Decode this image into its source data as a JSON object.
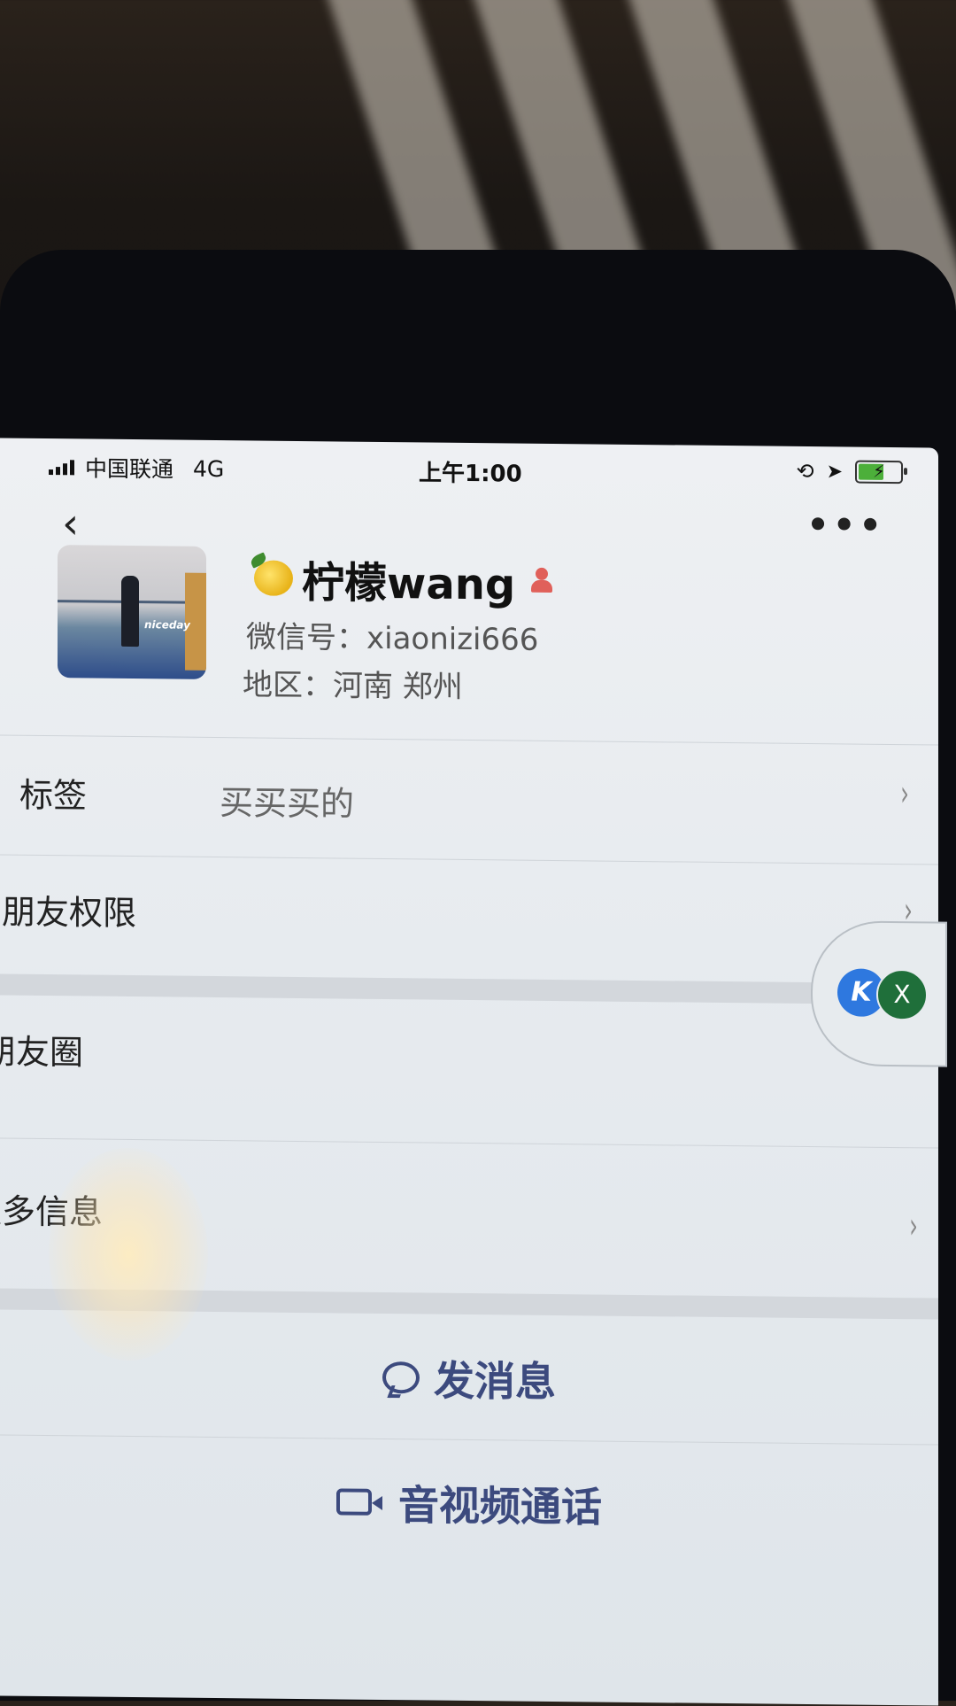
{
  "status_bar": {
    "carrier": "中国联通",
    "network": "4G",
    "time": "上午1:00"
  },
  "nav": {
    "back_icon": "chevron-left-icon",
    "more_icon": "more-dots-icon",
    "more_glyph": "•••"
  },
  "profile": {
    "name": "柠檬wang",
    "wechat_id": "微信号：xiaonizi666",
    "region": "地区：河南 郑州",
    "avatar_caption": "niceday",
    "gender_icon": "female-icon"
  },
  "rows": {
    "tag_label": "标签",
    "tag_value": "买买买的",
    "permission_label": "朋友权限",
    "moments_label": "朋友圈",
    "more_info_label": "更多信息"
  },
  "floating": {
    "left_glyph": "K",
    "right_glyph": "X"
  },
  "actions": {
    "send_message": "发消息",
    "av_call": "音视频通话"
  },
  "colors": {
    "accent": "#3c4a7e",
    "battery": "#4caf3a",
    "female": "#e0605a"
  }
}
